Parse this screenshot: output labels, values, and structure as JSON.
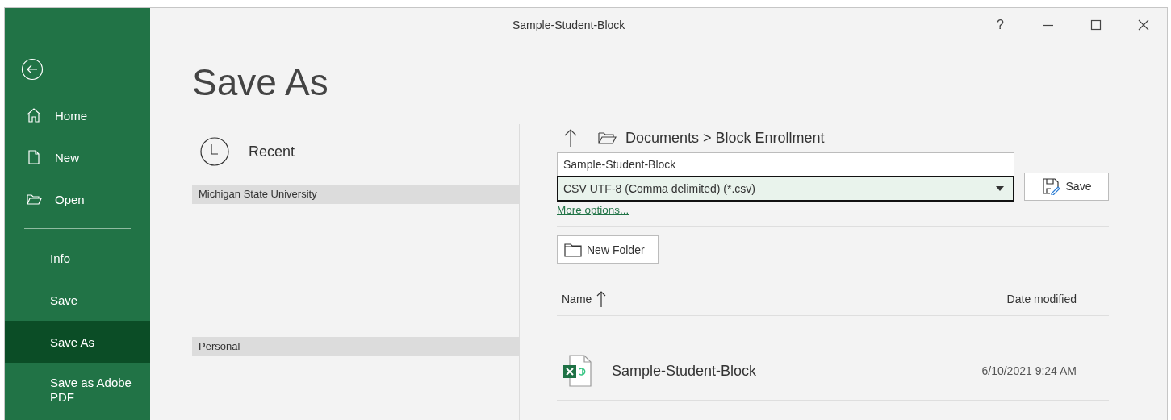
{
  "window": {
    "title": "Sample-Student-Block",
    "help": "?"
  },
  "page_title": "Save As",
  "sidebar": {
    "primary": [
      {
        "label": "Home",
        "selected": false
      },
      {
        "label": "New",
        "selected": false
      },
      {
        "label": "Open",
        "selected": false
      }
    ],
    "secondary": [
      {
        "label": "Info",
        "selected": false
      },
      {
        "label": "Save",
        "selected": false
      },
      {
        "label": "Save As",
        "selected": true
      },
      {
        "label": "Save as Adobe PDF",
        "selected": false
      }
    ]
  },
  "locations": {
    "recent": "Recent",
    "groups": [
      "Michigan State University",
      "Personal"
    ]
  },
  "breadcrumb": "Documents > Block Enrollment",
  "filename": {
    "value": "Sample-Student-Block"
  },
  "file_type": {
    "value": "CSV UTF-8 (Comma delimited) (*.csv)"
  },
  "save_button": "Save",
  "more_options": "More options...",
  "new_folder": "New Folder",
  "files": {
    "columns": [
      "Name",
      "Date modified"
    ],
    "rows": [
      {
        "name": "Sample-Student-Block",
        "date": "6/10/2021 9:24 AM"
      }
    ]
  }
}
